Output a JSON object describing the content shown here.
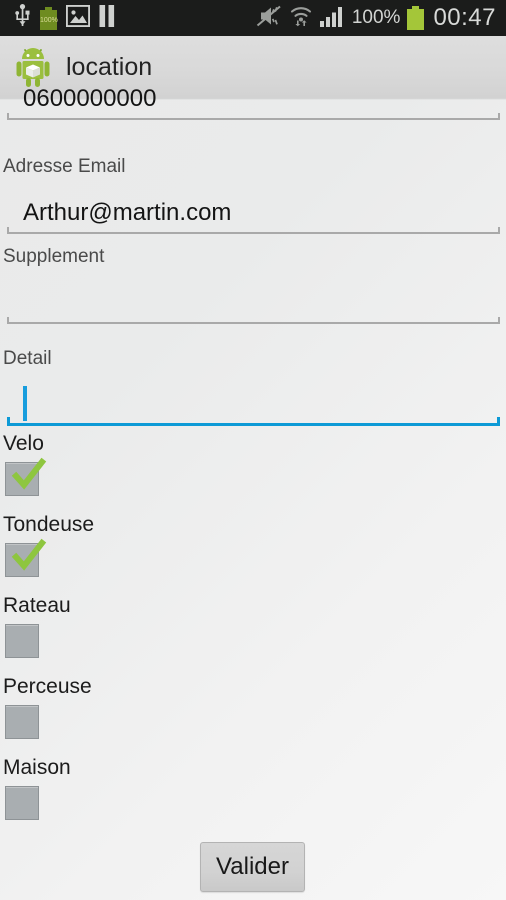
{
  "status_bar": {
    "left_icons": [
      "usb-icon",
      "battery-charging-icon",
      "image-icon",
      "pause-icon"
    ],
    "battery_left_percent": "100%",
    "right_icons": [
      "mute-vibrate-icon",
      "wifi-transfer-icon",
      "signal-bars-icon",
      "battery-icon"
    ],
    "battery_percent": "100%",
    "clock": "00:47"
  },
  "action_bar": {
    "icon": "android-robot-icon",
    "title": "location"
  },
  "form": {
    "phone": {
      "value": "0600000000",
      "placeholder": "",
      "focused": false
    },
    "email": {
      "label": "Adresse Email",
      "value": "Arthur@martin.com",
      "placeholder": "",
      "focused": false
    },
    "supplement": {
      "label": "Supplement",
      "value": "",
      "placeholder": "",
      "focused": false
    },
    "detail": {
      "label": "Detail",
      "value": "",
      "placeholder": "",
      "focused": true
    },
    "checkboxes": [
      {
        "label": "Velo",
        "checked": true
      },
      {
        "label": "Tondeuse",
        "checked": true
      },
      {
        "label": "Rateau",
        "checked": false
      },
      {
        "label": "Perceuse",
        "checked": false
      },
      {
        "label": "Maison",
        "checked": false
      }
    ],
    "submit_label": "Valider"
  },
  "colors": {
    "accent_blue": "#0d9ad6",
    "check_green": "#8ec63f",
    "status_bar_bg": "#1b1c1b",
    "action_bar_bg": "#d9d9d9",
    "checkbox_gray": "#a9aeb1",
    "battery_green": "#a4c639"
  }
}
